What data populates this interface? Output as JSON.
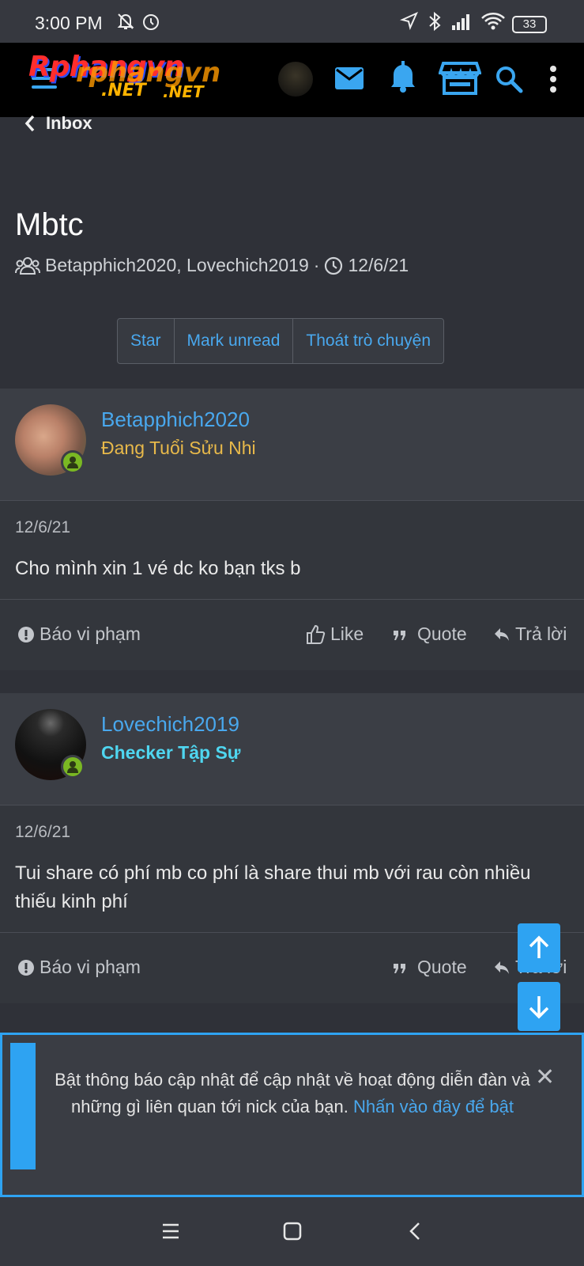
{
  "status_bar": {
    "time": "3:00 PM",
    "battery": "33"
  },
  "header": {
    "logo_text": "Rphangvn",
    "logo_sub": ".NET"
  },
  "nav": {
    "back_label": "Inbox"
  },
  "conversation": {
    "title": "Mbtc",
    "participants": "Betapphich2020, Lovechich2019",
    "separator": "·",
    "date": "12/6/21",
    "actions": [
      "Star",
      "Mark unread",
      "Thoát trò chuyện"
    ]
  },
  "messages": [
    {
      "username": "Betapphich2020",
      "user_title": "Đang Tuổi Sửu Nhi",
      "user_title_color": "#e8b94a",
      "date": "12/6/21",
      "text": "Cho mình xin 1 vé dc ko bạn tks b",
      "report": "Báo vi phạm",
      "like": "Like",
      "quote": "Quote",
      "reply": "Trả lời"
    },
    {
      "username": "Lovechich2019",
      "user_title": "Checker Tập Sự",
      "user_title_color": "#4fd6f0",
      "date": "12/6/21",
      "text": "Tui share có phí mb co phí là share thui mb với rau còn nhiều thiếu kinh phí",
      "report": "Báo vi phạm",
      "quote": "Quote",
      "reply": "Trả lời"
    }
  ],
  "notice": {
    "text": "Bật thông báo cập nhật để cập nhật về hoạt động diễn đàn và những gì liên quan tới nick của bạn.",
    "link": "Nhấn vào đây để bật"
  },
  "colors": {
    "accent": "#2ea3f2",
    "link": "#49a8ee",
    "online": "#7ab823"
  }
}
